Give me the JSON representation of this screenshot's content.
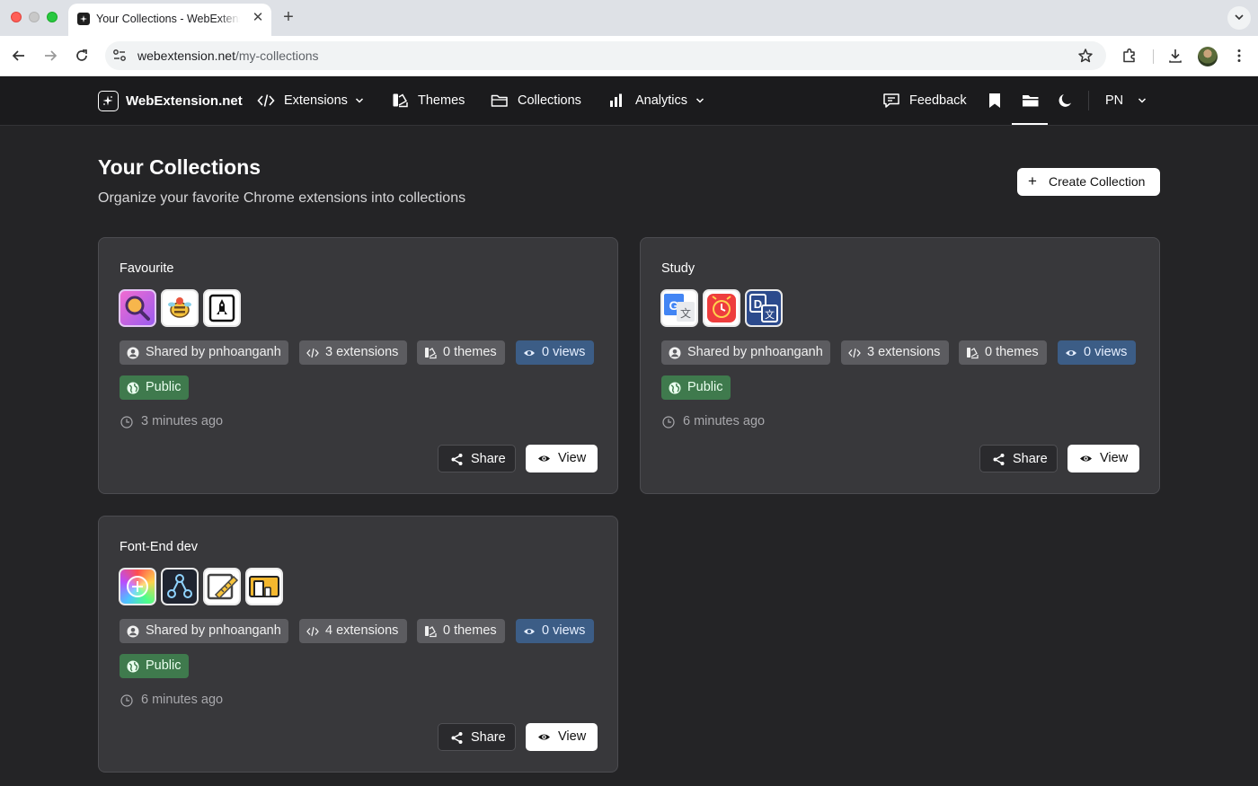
{
  "browser": {
    "tab_title": "Your Collections - WebExtension.net",
    "tab_close": "✕",
    "new_tab": "+",
    "url_domain": "webextension.net",
    "url_path": "/my-collections"
  },
  "nav": {
    "logo": "WebExtension.net",
    "extensions": "Extensions",
    "themes": "Themes",
    "collections": "Collections",
    "analytics": "Analytics",
    "feedback": "Feedback",
    "language": "PN"
  },
  "page": {
    "title": "Your Collections",
    "subtitle": "Organize your favorite Chrome extensions into collections",
    "create_label": "Create Collection",
    "create_plus": "+"
  },
  "collections": [
    {
      "name": "Favourite",
      "shared": "Shared by pnhoanganh",
      "extensions": "3 extensions",
      "themes": "0 themes",
      "views": "0 views",
      "visibility": "Public",
      "time": "3 minutes ago",
      "share_label": "Share",
      "view_label": "View",
      "icons": [
        "magnifier-icon",
        "bee-icon",
        "rocket-icon"
      ]
    },
    {
      "name": "Study",
      "shared": "Shared by pnhoanganh",
      "extensions": "3 extensions",
      "themes": "0 themes",
      "views": "0 views",
      "visibility": "Public",
      "time": "6 minutes ago",
      "share_label": "Share",
      "view_label": "View",
      "icons": [
        "google-translate-icon",
        "clock-icon",
        "dictionary-icon"
      ]
    },
    {
      "name": "Font-End dev",
      "shared": "Shared by pnhoanganh",
      "extensions": "4 extensions",
      "themes": "0 themes",
      "views": "0 views",
      "visibility": "Public",
      "time": "6 minutes ago",
      "share_label": "Share",
      "view_label": "View",
      "icons": [
        "color-picker-icon",
        "graph-nodes-icon",
        "ruler-icon",
        "responsive-icon"
      ]
    }
  ],
  "colors": {
    "page_bg": "#242426",
    "card_bg": "#38383b",
    "chip_gray": "#5c5c60",
    "chip_blue": "#3c5d86",
    "chip_green": "#3f7a4d"
  }
}
